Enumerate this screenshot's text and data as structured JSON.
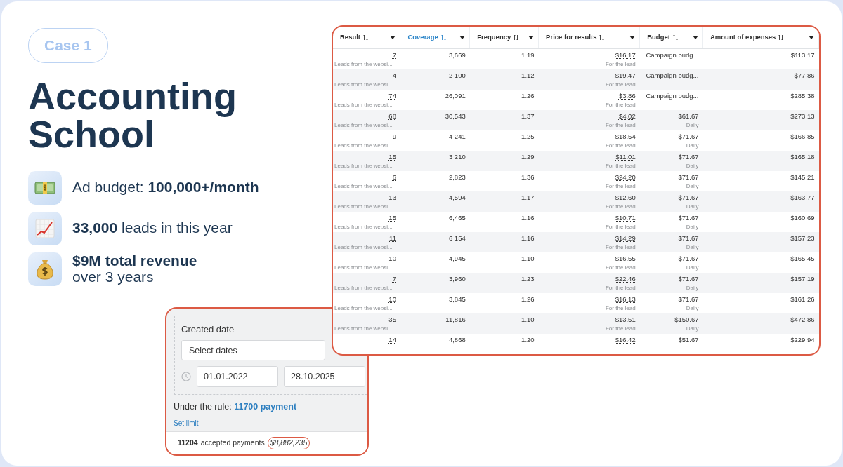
{
  "badge": "Case 1",
  "title": "Accounting School",
  "stats": [
    {
      "kind": "cash",
      "text": "Ad budget: **100,000+/month**"
    },
    {
      "kind": "chart",
      "text": "**33,000** leads in this year"
    },
    {
      "kind": "moneybag",
      "text": "**$9M total revenue**",
      "line2": "over 3 years"
    }
  ],
  "table": {
    "columns": [
      {
        "label": "Result",
        "selected": false
      },
      {
        "label": "Coverage",
        "selected": true
      },
      {
        "label": "Frequency",
        "selected": false
      },
      {
        "label": "Price for results",
        "selected": false
      },
      {
        "label": "Budget",
        "selected": false
      },
      {
        "label": "Amount of expenses",
        "selected": false
      }
    ],
    "rows": [
      {
        "result": "7",
        "result_sub": "Leads from the websi...",
        "coverage": "3,669",
        "frequency": "1.19",
        "price": "$16.17",
        "price_sub": "For the lead",
        "budget": "Campaign budg...",
        "expenses": "$113.17"
      },
      {
        "result": "4",
        "result_sub": "Leads from the websi...",
        "coverage": "2 100",
        "frequency": "1.12",
        "price": "$19.47",
        "price_sub": "For the lead",
        "budget": "Campaign budg...",
        "expenses": "$77.86"
      },
      {
        "result": "74",
        "result_sub": "Leads from the websi...",
        "coverage": "26,091",
        "frequency": "1.26",
        "price": "$3.86",
        "price_sub": "For the lead",
        "budget": "Campaign budg...",
        "expenses": "$285.38"
      },
      {
        "result": "68",
        "result_sub": "Leads from the websi...",
        "coverage": "30,543",
        "frequency": "1.37",
        "price": "$4.02",
        "price_sub": "For the lead",
        "budget": "$61.67",
        "budget_sub": "Daily",
        "expenses": "$273.13"
      },
      {
        "result": "9",
        "result_sub": "Leads from the websi...",
        "coverage": "4 241",
        "frequency": "1.25",
        "price": "$18.54",
        "price_sub": "For the lead",
        "budget": "$71.67",
        "budget_sub": "Daily",
        "expenses": "$166.85"
      },
      {
        "result": "15",
        "result_sub": "Leads from the websi...",
        "coverage": "3 210",
        "frequency": "1.29",
        "price": "$11.01",
        "price_sub": "For the lead",
        "budget": "$71.67",
        "budget_sub": "Daily",
        "expenses": "$165.18"
      },
      {
        "result": "6",
        "result_sub": "Leads from the websi...",
        "coverage": "2,823",
        "frequency": "1.36",
        "price": "$24.20",
        "price_sub": "For the lead",
        "budget": "$71.67",
        "budget_sub": "Daily",
        "expenses": "$145.21"
      },
      {
        "result": "13",
        "result_sub": "Leads from the websi...",
        "coverage": "4,594",
        "frequency": "1.17",
        "price": "$12.60",
        "price_sub": "For the lead",
        "budget": "$71.67",
        "budget_sub": "Daily",
        "expenses": "$163.77"
      },
      {
        "result": "15",
        "result_sub": "Leads from the websi...",
        "coverage": "6,465",
        "frequency": "1.16",
        "price": "$10.71",
        "price_sub": "For the lead",
        "budget": "$71.67",
        "budget_sub": "Daily",
        "expenses": "$160.69"
      },
      {
        "result": "11",
        "result_sub": "Leads from the websi...",
        "coverage": "6 154",
        "frequency": "1.16",
        "price": "$14.29",
        "price_sub": "For the lead",
        "budget": "$71.67",
        "budget_sub": "Daily",
        "expenses": "$157.23"
      },
      {
        "result": "10",
        "result_sub": "Leads from the websi...",
        "coverage": "4,945",
        "frequency": "1.10",
        "price": "$16.55",
        "price_sub": "For the lead",
        "budget": "$71.67",
        "budget_sub": "Daily",
        "expenses": "$165.45"
      },
      {
        "result": "7",
        "result_sub": "Leads from the websi...",
        "coverage": "3,960",
        "frequency": "1.23",
        "price": "$22.46",
        "price_sub": "For the lead",
        "budget": "$71.67",
        "budget_sub": "Daily",
        "expenses": "$157.19"
      },
      {
        "result": "10",
        "result_sub": "Leads from the websi...",
        "coverage": "3,845",
        "frequency": "1.26",
        "price": "$16.13",
        "price_sub": "For the lead",
        "budget": "$71.67",
        "budget_sub": "Daily",
        "expenses": "$161.26"
      },
      {
        "result": "35",
        "result_sub": "Leads from the websi...",
        "coverage": "11,816",
        "frequency": "1.10",
        "price": "$13.51",
        "price_sub": "For the lead",
        "budget": "$150.67",
        "budget_sub": "Daily",
        "expenses": "$472.86"
      },
      {
        "result": "14",
        "coverage": "4,868",
        "frequency": "1.20",
        "price": "$16.42",
        "budget": "$51.67",
        "expenses": "$229.94"
      }
    ]
  },
  "filter": {
    "label": "Created date",
    "select_placeholder": "Select dates",
    "date_from": "01.01.2022",
    "date_to": "28.10.2025",
    "rule": "Under the rule: **11700 payment**",
    "link": "Set limit",
    "count": "11204",
    "count_label": "accepted payments",
    "amount": "$8,882,235"
  }
}
